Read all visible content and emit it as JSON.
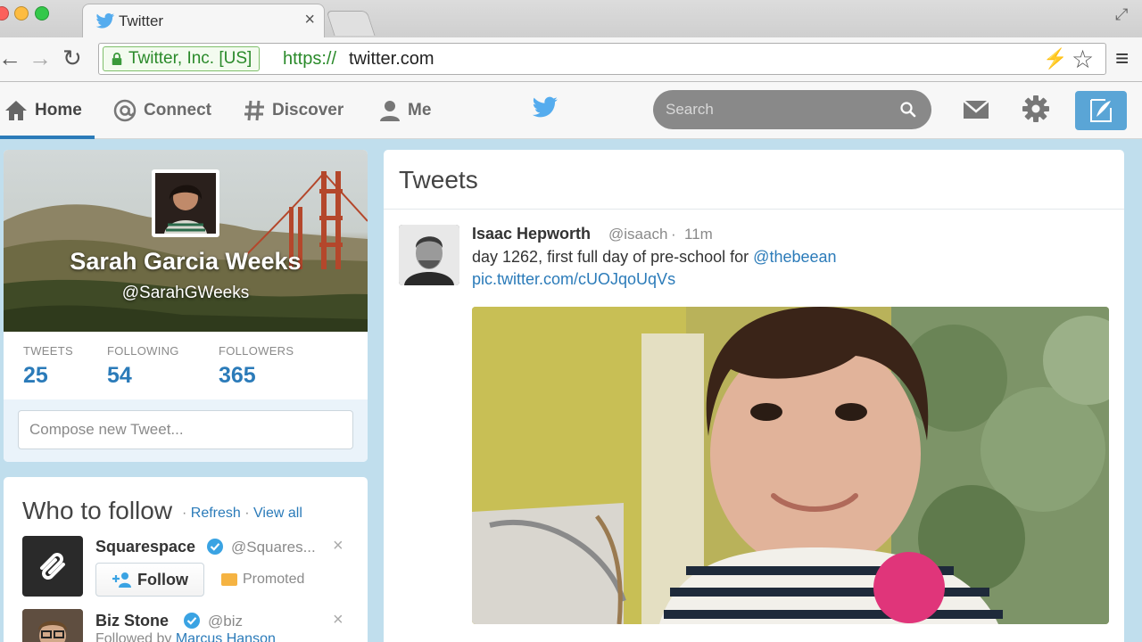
{
  "browser": {
    "tab_title": "Twitter",
    "ev_label": "Twitter, Inc. [US]",
    "url_scheme": "https://",
    "url_host": "twitter.com"
  },
  "nav": {
    "home": "Home",
    "connect": "Connect",
    "discover": "Discover",
    "me": "Me",
    "search_placeholder": "Search"
  },
  "profile": {
    "name": "Sarah Garcia Weeks",
    "handle": "@SarahGWeeks",
    "stats": [
      {
        "label": "TWEETS",
        "value": "25"
      },
      {
        "label": "FOLLOWING",
        "value": "54"
      },
      {
        "label": "FOLLOWERS",
        "value": "365"
      }
    ],
    "compose_placeholder": "Compose new Tweet..."
  },
  "who_to_follow": {
    "title": "Who to follow",
    "sep1": "·",
    "refresh": "Refresh",
    "sep2": "·",
    "view_all": "View all",
    "suggestions": [
      {
        "name": "Squarespace",
        "handle": "@Squares...",
        "follow_label": "Follow",
        "promoted_label": "Promoted"
      },
      {
        "name": "Biz Stone",
        "handle": "@biz",
        "followed_by_prefix": "Followed by",
        "followed_by_name": "Marcus Hanson"
      }
    ]
  },
  "timeline": {
    "title": "Tweets",
    "tweet": {
      "name": "Isaac Hepworth",
      "handle": "@isaach",
      "sep": "·",
      "time": "11m",
      "text": "day 1262, first full day of pre-school for ",
      "mention": "@thebeean",
      "link": "pic.twitter.com/cUOJqoUqVs"
    }
  },
  "colors": {
    "link": "#2b7bb9",
    "accent": "#5aa5d6",
    "page_bg": "#c0deed"
  }
}
